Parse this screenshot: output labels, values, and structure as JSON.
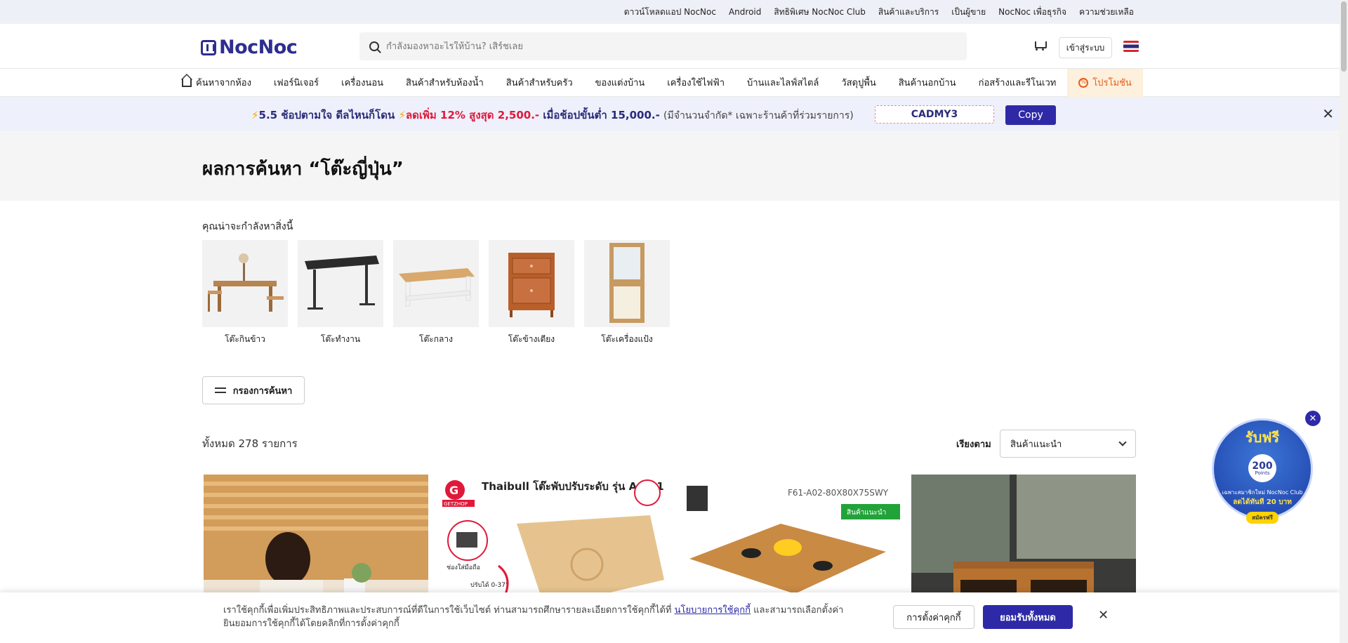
{
  "utility_links": [
    "ดาวน์โหลดแอป NocNoc",
    "Android",
    "สิทธิพิเศษ NocNoc Club",
    "สินค้าและบริการ",
    "เป็นผู้ขาย",
    "NocNoc เพื่อธุรกิจ",
    "ความช่วยเหลือ"
  ],
  "header": {
    "logo_text": "NocNoc",
    "search_placeholder": "กำลังมองหาอะไรให้บ้าน? เสิร์ชเลย",
    "login_label": "เข้าสู่ระบบ"
  },
  "categories": [
    "ค้นหาจากห้อง",
    "เฟอร์นิเจอร์",
    "เครื่องนอน",
    "สินค้าสำหรับห้องน้ำ",
    "สินค้าสำหรับครัว",
    "ของแต่งบ้าน",
    "เครื่องใช้ไฟฟ้า",
    "บ้านและไลฟ์สไตล์",
    "วัสดุปูพื้น",
    "สินค้านอกบ้าน",
    "ก่อสร้างและรีโนเวท",
    "โปรโมชัน"
  ],
  "banner": {
    "part1": "5.5 ช้อปตามใจ ดีลไหนก็โดน",
    "part2": "ลดเพิ่ม 12% สูงสุด 2,500.-",
    "part3": "เมื่อช้อปขั้นต่ำ 15,000.-",
    "part4": "(มีจำนวนจำกัด* เฉพาะร้านค้าที่ร่วมรายการ)",
    "code": "CADMY3",
    "copy_label": "Copy"
  },
  "results": {
    "title": "ผลการค้นหา “โต๊ะญี่ปุ่น”",
    "suggest_title": "คุณน่าจะกำลังหาสิ่งนี้",
    "suggestions": [
      "โต๊ะกินข้าว",
      "โต๊ะทำงาน",
      "โต๊ะกลาง",
      "โต๊ะข้างเตียง",
      "โต๊ะเครื่องแป้ง"
    ],
    "filter_label": "กรองการค้นหา",
    "total_text": "ทั้งหมด 278 รายการ",
    "sort_label": "เรียงตาม",
    "sort_value": "สินค้าแนะนำ"
  },
  "products": [
    {
      "image_text": ""
    },
    {
      "image_text": "Thaibull โต๊ะพับปรับระดับ รุ่น A-B01",
      "brand": "GETZHOP",
      "note1": "ช่องใส่มือถือ",
      "note2": "ปรับได้ 0-37°"
    },
    {
      "image_text": "F61-A02-80X80X75SWY",
      "badge": "สินค้าแนะนำ"
    },
    {
      "image_text": ""
    }
  ],
  "reward": {
    "title": "รับฟรี",
    "points": "200",
    "points_unit": "Points",
    "sub1": "เฉพาะสมาชิกใหม่ NocNoc Club",
    "sub2": "ลดได้ทันที 20 บาท",
    "button": "สมัครฟรี"
  },
  "cookie": {
    "text_before": "เราใช้คุกกี้เพื่อเพิ่มประสิทธิภาพและประสบการณ์ที่ดีในการใช้เว็บไซต์ ท่านสามารถศึกษารายละเอียดการใช้คุกกี้ได้ที่",
    "link": "นโยบายการใช้คุกกี้",
    "text_after": "และสามารถเลือกตั้งค่ายินยอมการใช้คุกกี้ได้โดยคลิกที่การตั้งค่าคุกกี้",
    "settings_label": "การตั้งค่าคุกกี้",
    "accept_label": "ยอมรับทั้งหมด"
  },
  "colors": {
    "brand": "#2e2aa7",
    "promo": "#e85d1c",
    "accent_red": "#e0193a"
  }
}
